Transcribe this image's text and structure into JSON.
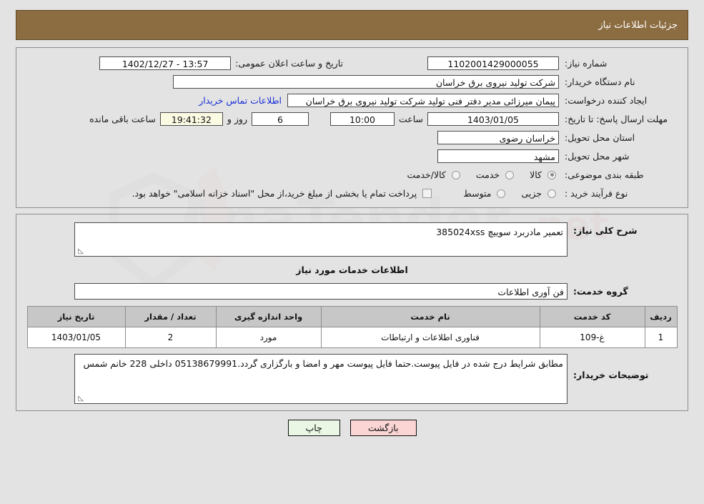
{
  "header": {
    "title": "جزئیات اطلاعات نیاز"
  },
  "top_form": {
    "need_number_label": "شماره نیاز:",
    "need_number_value": "1102001429000055",
    "announce_datetime_label": "تاریخ و ساعت اعلان عمومی:",
    "announce_datetime_value": "13:57 - 1402/12/27",
    "buyer_org_label": "نام دستگاه خریدار:",
    "buyer_org_value": "شرکت تولید نیروی برق خراسان",
    "creator_label": "ایجاد کننده درخواست:",
    "creator_value": "پیمان میرزائی مدیر دفتر فنی تولید شرکت تولید نیروی برق خراسان",
    "contact_link": "اطلاعات تماس خریدار",
    "deadline_label": "مهلت ارسال پاسخ: تا تاریخ:",
    "deadline_date": "1403/01/05",
    "deadline_hour_label": "ساعت",
    "deadline_hour": "10:00",
    "days_value": "6",
    "days_label": "روز و",
    "timer_value": "19:41:32",
    "timer_label": "ساعت باقی مانده",
    "province_label": "استان محل تحویل:",
    "province_value": "خراسان رضوی",
    "city_label": "شهر محل تحویل:",
    "city_value": "مشهد",
    "category_label": "طبقه بندی موضوعی:",
    "category_options": [
      {
        "label": "کالا",
        "selected": true
      },
      {
        "label": "خدمت",
        "selected": false
      },
      {
        "label": "کالا/خدمت",
        "selected": false
      }
    ],
    "process_label": "نوع فرآیند خرید :",
    "process_options": [
      {
        "label": "جزیی",
        "selected": false
      },
      {
        "label": "متوسط",
        "selected": false
      }
    ],
    "treasury_checkbox_label": "پرداخت تمام یا بخشی از مبلغ خرید،از محل \"اسناد خزانه اسلامی\" خواهد بود.",
    "treasury_checked": false
  },
  "mid_form": {
    "general_desc_label": "شرح کلی نیاز:",
    "general_desc_value": "تعمیر مادربرد سوییچ 385024xss",
    "services_section_title": "اطلاعات خدمات مورد نیاز",
    "service_group_label": "گروه خدمت:",
    "service_group_value": "فن آوری اطلاعات",
    "table": {
      "columns": [
        "ردیف",
        "کد خدمت",
        "نام خدمت",
        "واحد اندازه گیری",
        "تعداد / مقدار",
        "تاریخ نیاز"
      ],
      "rows": [
        [
          "1",
          "غ-109",
          "فناوری اطلاعات و ارتباطات",
          "مورد",
          "2",
          "1403/01/05"
        ]
      ]
    },
    "buyer_notes_label": "توضیحات خریدار:",
    "buyer_notes_value": "مطابق شرایط درج شده در فایل پیوست.حتما فایل پیوست مهر و امضا و بارگزاری گردد.05138679991 داخلی 228 خانم شمس"
  },
  "footer": {
    "print_label": "چاپ",
    "back_label": "بازگشت"
  },
  "watermark": {
    "text": "AnaTender.net"
  },
  "colors": {
    "header_bg": "#8c6d42",
    "page_bg": "#e3e3e3",
    "link": "#1b2fd4",
    "timer_bg": "#fbfbe4",
    "table_header_bg": "#c7c7c7",
    "back_btn_bg": "#fbd4d4",
    "print_btn_bg": "#e9f7e4"
  }
}
